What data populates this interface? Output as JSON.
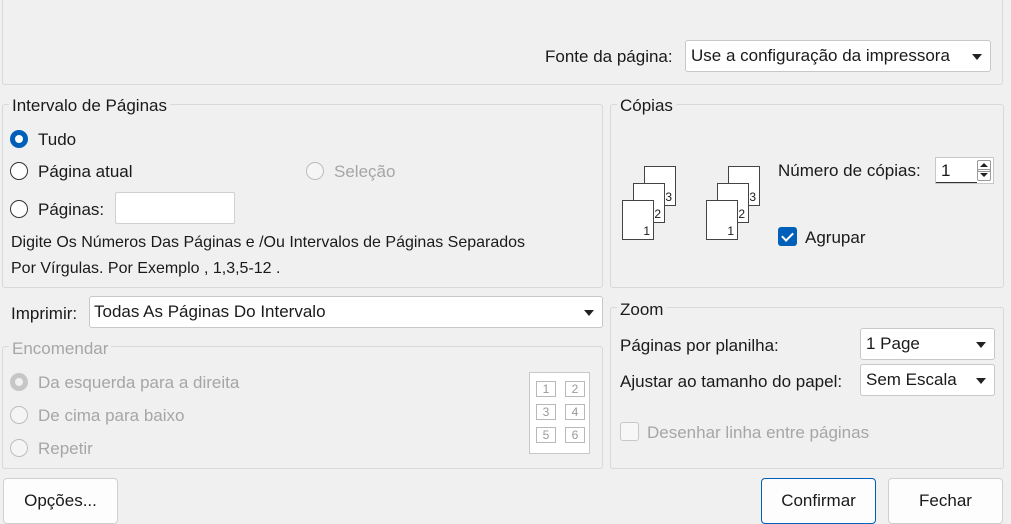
{
  "top": {
    "page_source_label": "Fonte da página:",
    "page_source_value": "Use a configuração da impressora"
  },
  "range": {
    "legend": "Intervalo de Páginas",
    "all": "Tudo",
    "current": "Página atual",
    "selection": "Seleção",
    "pages": "Páginas:",
    "pages_value": "",
    "hint_line1": "Digite Os Números Das Páginas e /Ou Intervalos de Páginas Separados",
    "hint_line2": "Por Vírgulas. Por Exemplo , 1,3,5-12 ."
  },
  "copies": {
    "legend": "Cópias",
    "count_label": "Número de cópias:",
    "count_value": "1",
    "collate": "Agrupar",
    "page_numbers": [
      "1",
      "2",
      "3"
    ]
  },
  "print": {
    "label": "Imprimir:",
    "value": "Todas As Páginas Do Intervalo"
  },
  "order": {
    "legend": "Encomendar",
    "left_to_right": "Da esquerda para a direita",
    "top_to_bottom": "De cima para baixo",
    "repeat": "Repetir",
    "grid": [
      "1",
      "2",
      "3",
      "4",
      "5",
      "6"
    ]
  },
  "zoom": {
    "legend": "Zoom",
    "pages_per_sheet_label": "Páginas por planilha:",
    "pages_per_sheet_value": "1 Page",
    "scale_label": "Ajustar ao tamanho do papel:",
    "scale_value": "Sem Escala",
    "draw_lines": "Desenhar linha entre páginas"
  },
  "buttons": {
    "options": "Opções...",
    "confirm": "Confirmar",
    "close": "Fechar"
  }
}
